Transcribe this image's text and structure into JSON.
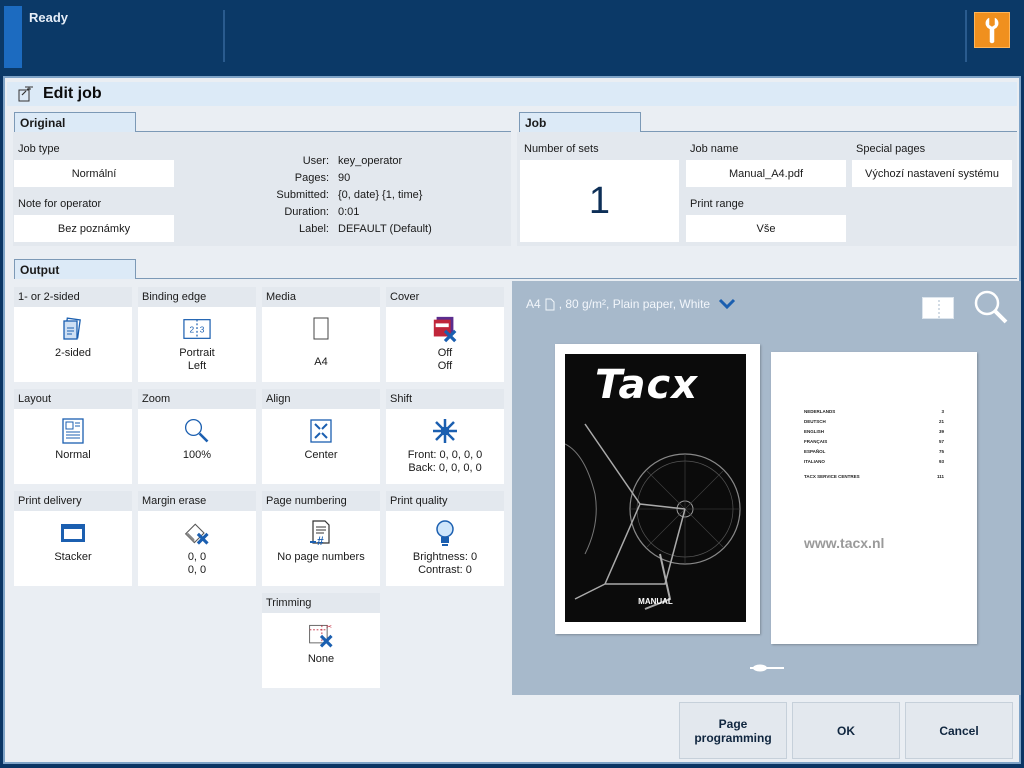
{
  "status": {
    "text": "Ready"
  },
  "title": "Edit job",
  "original": {
    "tab": "Original",
    "job_type_label": "Job type",
    "job_type_value": "Normální",
    "note_label": "Note for operator",
    "note_value": "Bez poznámky",
    "info": [
      {
        "key": "User:",
        "value": "key_operator"
      },
      {
        "key": "Pages:",
        "value": "90"
      },
      {
        "key": "Submitted:",
        "value": "{0, date} {1, time}"
      },
      {
        "key": "Duration:",
        "value": "0:01"
      },
      {
        "key": "Label:",
        "value": "DEFAULT (Default)"
      }
    ]
  },
  "job": {
    "tab": "Job",
    "sets_label": "Number of sets",
    "sets_value": "1",
    "name_label": "Job name",
    "name_value": "Manual_A4.pdf",
    "special_label": "Special pages",
    "special_value": "Výchozí nastavení systému",
    "range_label": "Print range",
    "range_value": "Vše"
  },
  "output": {
    "tab": "Output",
    "tiles": [
      {
        "label": "1- or 2-sided",
        "value": "2-sided",
        "icon": "two-sided-icon"
      },
      {
        "label": "Binding edge",
        "value": "Portrait\nLeft",
        "icon": "binding-edge-icon"
      },
      {
        "label": "Media",
        "value": "A4",
        "icon": "media-sheet-icon"
      },
      {
        "label": "Cover",
        "value": "Off\nOff",
        "icon": "cover-off-icon"
      },
      {
        "label": "Layout",
        "value": "Normal",
        "icon": "layout-icon"
      },
      {
        "label": "Zoom",
        "value": "100%",
        "icon": "zoom-icon"
      },
      {
        "label": "Align",
        "value": "Center",
        "icon": "align-center-icon"
      },
      {
        "label": "Shift",
        "value": "Front: 0, 0, 0, 0\nBack: 0, 0, 0, 0",
        "icon": "shift-icon"
      },
      {
        "label": "Print delivery",
        "value": "Stacker",
        "icon": "stacker-icon"
      },
      {
        "label": "Margin erase",
        "value": "0, 0\n0, 0",
        "icon": "margin-erase-icon"
      },
      {
        "label": "Page numbering",
        "value": "No page numbers",
        "icon": "page-numbering-icon"
      },
      {
        "label": "Print quality",
        "value": "Brightness: 0\nContrast: 0",
        "icon": "print-quality-icon"
      },
      {
        "label": "Trimming",
        "value": "None",
        "icon": "trimming-icon"
      }
    ]
  },
  "preview": {
    "media_prefix": "A4",
    "media_desc": ", 80 g/m², Plain paper, White",
    "cover_brand": "Tacx",
    "cover_sub": "MANUAL",
    "toc": [
      {
        "lang": "NEDERLANDS",
        "page": "3"
      },
      {
        "lang": "DEUTSCH",
        "page": "21"
      },
      {
        "lang": "ENGLISH",
        "page": "39"
      },
      {
        "lang": "FRANÇAIS",
        "page": "57"
      },
      {
        "lang": "ESPAÑOL",
        "page": "75"
      },
      {
        "lang": "ITALIANO",
        "page": "93"
      },
      {
        "lang": "TACX SERVICE CENTRES",
        "page": "111"
      }
    ],
    "website": "www.tacx.nl"
  },
  "buttons": {
    "page_programming": "Page programming",
    "ok": "OK",
    "cancel": "Cancel"
  },
  "colors": {
    "topbar": "#0b3967",
    "accent": "#1c6bc0",
    "tools_button": "#f0901e",
    "icon_blue": "#1b5fb0",
    "icon_red": "#c0263a"
  }
}
